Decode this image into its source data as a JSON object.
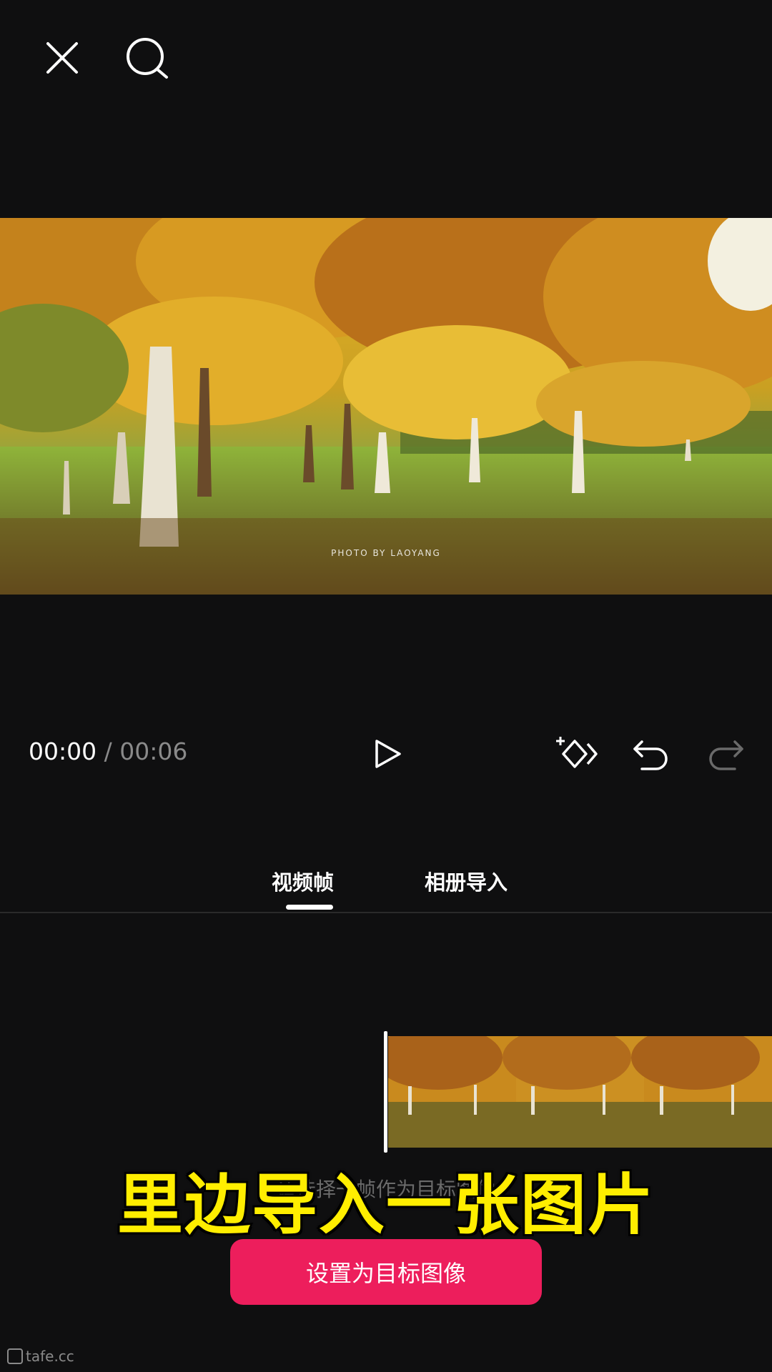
{
  "header": {
    "close_icon": "close-icon",
    "search_icon": "search-icon"
  },
  "preview": {
    "watermark": "PHOTO BY LAOYANG"
  },
  "playback": {
    "current_time": "00:00",
    "separator": "/",
    "duration": "00:06",
    "play_icon": "play-icon",
    "keyframe_icon": "keyframe-add-icon",
    "undo_icon": "undo-icon",
    "redo_icon": "redo-icon"
  },
  "tabs": [
    {
      "label": "视频帧",
      "active": true
    },
    {
      "label": "相册导入",
      "active": false
    }
  ],
  "hint_text": "请选择一帧作为目标图像",
  "caption": "里边导入一张图片",
  "primary_button": {
    "label": "设置为目标图像",
    "color": "#ed1e5c"
  },
  "brand": "tafe.cc",
  "colors": {
    "background": "#0f0f10",
    "caption": "#ffee00",
    "accent": "#ed1e5c"
  }
}
